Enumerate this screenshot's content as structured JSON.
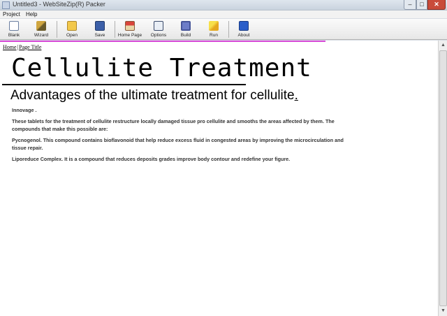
{
  "window": {
    "title": "Untitled3 - WebSiteZip(R) Packer",
    "minimize": "–",
    "maximize": "□",
    "close": "✕"
  },
  "menu": {
    "items": [
      "Project",
      "Help"
    ]
  },
  "toolbar": {
    "items": [
      {
        "label": "Blank",
        "icon": "blank-page-icon"
      },
      {
        "label": "Wizard",
        "icon": "wizard-wand-icon"
      },
      {
        "label": "Open",
        "icon": "folder-open-icon"
      },
      {
        "label": "Save",
        "icon": "floppy-save-icon"
      },
      {
        "label": "Home Page",
        "icon": "home-icon"
      },
      {
        "label": "Options",
        "icon": "options-icon"
      },
      {
        "label": "Build",
        "icon": "gear-icon"
      },
      {
        "label": "Run",
        "icon": "run-icon"
      },
      {
        "label": "About",
        "icon": "info-icon"
      }
    ]
  },
  "page": {
    "breadcrumb": {
      "home": "Home",
      "sep": "|",
      "current": "Page Title"
    },
    "title": "Cellulite Treatment",
    "subtitle": "Advantages of the ultimate treatment for cellulite",
    "subtitle_tail": ".",
    "paragraphs": [
      "Innovage .",
      "These tablets for the treatment of cellulite restructure locally damaged tissue pro cellulite and smooths the areas affected by them. The compounds that make this possible are:",
      "Pycnogenol. This compound contains bioflavonoid that help reduce excess fluid in congested areas by improving the microcirculation and tissue repair.",
      "Liporeduce Complex. It is a compound that reduces deposits grades improve body contour and redefine your figure."
    ]
  },
  "scrollbar": {
    "up": "▲",
    "down": "▼"
  },
  "colors": {
    "accent_line": "#d84ad8",
    "close_button": "#c94b3a"
  }
}
